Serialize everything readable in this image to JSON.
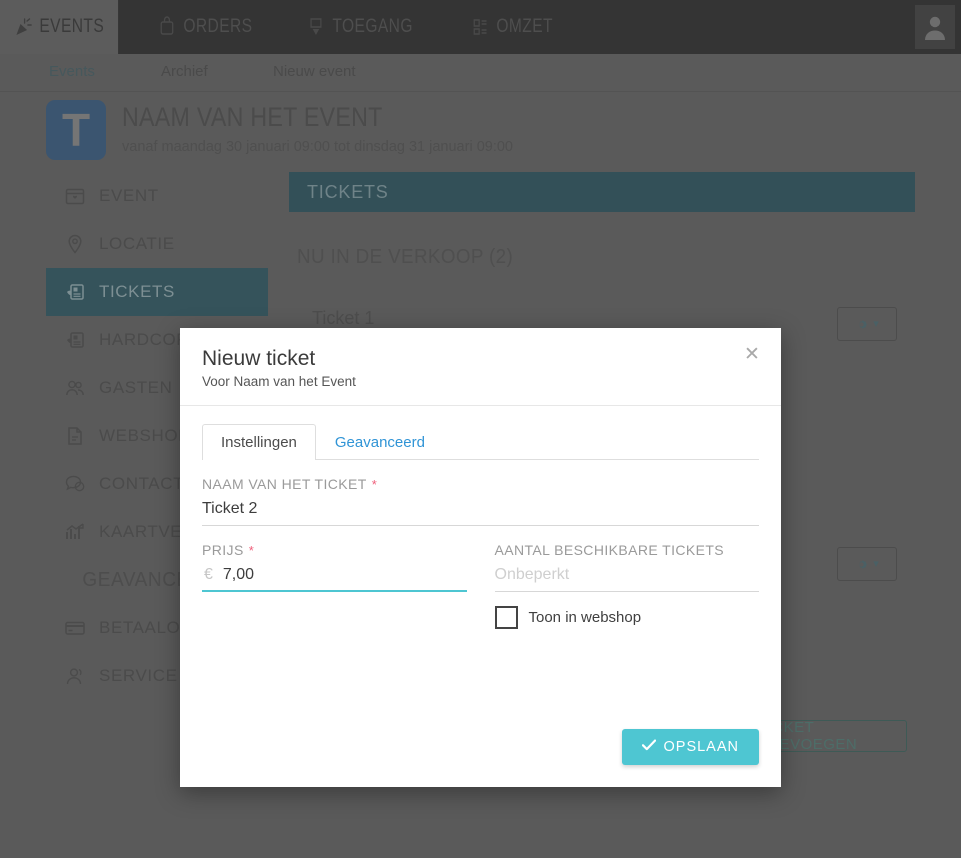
{
  "topnav": {
    "items": [
      {
        "label": "Events",
        "icon": "party-popper-icon",
        "active": true
      },
      {
        "label": "Orders",
        "icon": "cart-icon",
        "active": false
      },
      {
        "label": "Toegang",
        "icon": "scan-icon",
        "active": false
      },
      {
        "label": "Omzet",
        "icon": "report-icon",
        "active": false
      }
    ],
    "avatar_icon": "user-avatar-icon"
  },
  "subnav": {
    "items": [
      {
        "label": "Events",
        "active": true
      },
      {
        "label": "Archief",
        "active": false
      },
      {
        "label": "Nieuw event",
        "active": false
      }
    ]
  },
  "event_header": {
    "logo_letter": "T",
    "title": "NAAM VAN HET EVENT",
    "subtitle": "vanaf maandag 30 januari 09:00 tot dinsdag 31 januari 09:00"
  },
  "sidebar": {
    "items": [
      {
        "label": "Event",
        "icon": "calendar-icon",
        "type": "item",
        "active": false
      },
      {
        "label": "Locatie",
        "icon": "map-pin-icon",
        "type": "item",
        "active": false
      },
      {
        "label": "Tickets",
        "icon": "ticket-icon",
        "type": "item",
        "active": true
      },
      {
        "label": "Hardcopies",
        "icon": "ticket-icon",
        "type": "item",
        "active": false
      },
      {
        "label": "Gasten",
        "icon": "users-icon",
        "type": "item",
        "active": false
      },
      {
        "label": "Webshop",
        "icon": "document-icon",
        "type": "item",
        "active": false
      },
      {
        "label": "Contact",
        "icon": "chat-icon",
        "type": "item",
        "active": false
      },
      {
        "label": "Kaartverkoop",
        "icon": "chart-icon",
        "type": "item",
        "active": false
      },
      {
        "label": "Geavanceerd",
        "icon": "",
        "type": "group",
        "active": false
      },
      {
        "label": "Betaalopties",
        "icon": "credit-card-icon",
        "type": "item",
        "active": false
      },
      {
        "label": "Service",
        "icon": "headset-icon",
        "type": "item",
        "active": false
      }
    ]
  },
  "main": {
    "panel_title": "TICKETS",
    "section_label": "NU IN DE VERKOOP (2)",
    "ticket_row_name": "Ticket 1",
    "gear_icon": "gear-icon",
    "chevron_icon": "chevron-down-icon",
    "add_ticket_label": "Ticket toevoegen"
  },
  "modal": {
    "title": "Nieuw ticket",
    "subtitle": "Voor Naam van het Event",
    "close_icon": "close-icon",
    "tabs": [
      {
        "label": "Instellingen",
        "active": true
      },
      {
        "label": "Geavanceerd",
        "active": false
      }
    ],
    "fields": {
      "name": {
        "label": "Naam van het ticket",
        "required_marker": "*",
        "value": "Ticket 2",
        "placeholder": ""
      },
      "price": {
        "label": "Prijs",
        "required_marker": "*",
        "currency": "€",
        "value": "7,00",
        "placeholder": ""
      },
      "amount": {
        "label": "Aantal beschikbare tickets",
        "value": "",
        "placeholder": "Onbeperkt"
      },
      "webshop_checkbox": {
        "label": "Toon in webshop",
        "checked": false
      }
    },
    "save_button": {
      "label": "Opslaan",
      "icon": "check-icon"
    }
  },
  "colors": {
    "accent_teal": "#4ec6d2",
    "panel_teal": "#335058",
    "sidebar_active": "#35535b",
    "link_blue": "#3094d6",
    "required_red": "#ef5f7a",
    "logo_blue": "#3b5570",
    "page_dim": "#5a5a5a",
    "topnav_dark": "#343434"
  }
}
